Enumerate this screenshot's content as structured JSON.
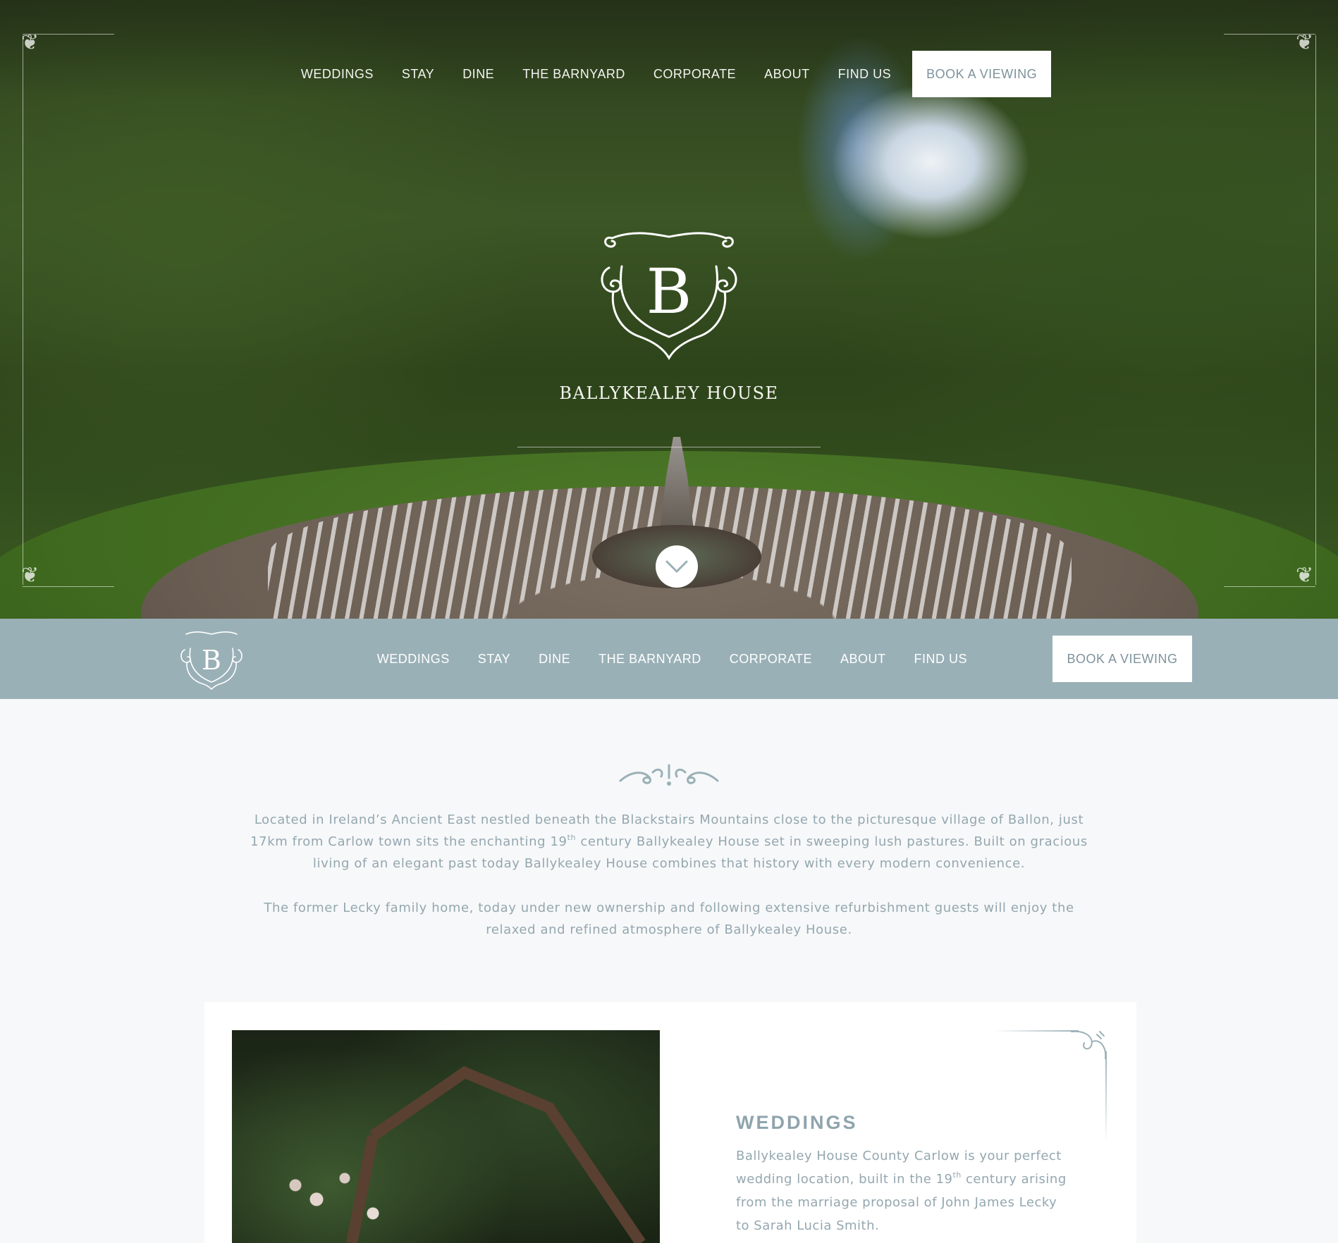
{
  "header": {
    "nav_items": [
      "WEDDINGS",
      "STAY",
      "DINE",
      "THE BARNYARD",
      "CORPORATE",
      "ABOUT",
      "FIND US"
    ],
    "cta_label": "BOOK A VIEWING"
  },
  "hero": {
    "brand_name": "BALLYKEALEY HOUSE",
    "logo_letter": "B",
    "scroll_icon": "chevron-down-icon"
  },
  "sticky_bar": {
    "logo_letter": "B",
    "nav_items": [
      "WEDDINGS",
      "STAY",
      "DINE",
      "THE BARNYARD",
      "CORPORATE",
      "ABOUT",
      "FIND US"
    ],
    "cta_label": "BOOK A VIEWING"
  },
  "intro": {
    "p1_a": "Located in Ireland’s Ancient East nestled beneath the Blackstairs Mountains close to the picturesque village of Ballon, just 17km from Carlow town sits the enchanting 19",
    "p1_sup": "th",
    "p1_b": " century Ballykealey House set in sweeping lush pastures. Built on gracious living of an elegant past today Ballykealey House combines that history with every modern convenience.",
    "p2": "The former Lecky family home, today under new ownership and following extensive refurbishment guests will enjoy the relaxed and refined atmosphere of Ballykealey House."
  },
  "weddings_card": {
    "title": "WEDDINGS",
    "text_a": "Ballykealey House County Carlow is your perfect wedding location, built in the 19",
    "text_sup": "th",
    "text_b": " century arising from the marriage proposal of John James Lecky to Sarah Lucia Smith."
  },
  "colors": {
    "accent": "#9ab0b7",
    "text_muted": "#94a7b0",
    "page_bg": "#f7f8f9",
    "button_text": "#7e939c"
  }
}
